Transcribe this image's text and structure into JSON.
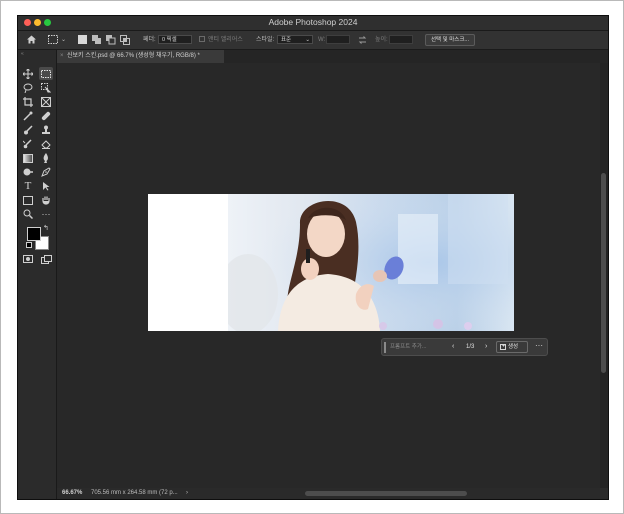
{
  "window": {
    "app_title": "Adobe Photoshop 2024"
  },
  "options_bar": {
    "feather_label": "페더:",
    "feather_value": "0 픽셀",
    "antialias_label": "앤티 앨리어스",
    "style_label": "스타일:",
    "style_value": "표준",
    "width_label": "W:",
    "height_label": "높이:",
    "select_mask_button": "선택 및 마스크..."
  },
  "document_tab": {
    "title": "신보키 스킨.psd @ 66.7% (생성형 채우기, RGB/8) *",
    "close": "×"
  },
  "contextual_bar": {
    "prompt_placeholder": "프롬프트 추가...",
    "prev": "‹",
    "next": "›",
    "variation_count": "1/3",
    "generate_button": "생성",
    "more": "···"
  },
  "status_bar": {
    "zoom": "66.67%",
    "doc_size": "705.56 mm x 264.58 mm (72 p...",
    "arrow": "›"
  },
  "colors": {
    "panel": "#2b2b2b",
    "canvas": "#282828",
    "foreground_swatch": "#000000",
    "background_swatch": "#ffffff"
  }
}
